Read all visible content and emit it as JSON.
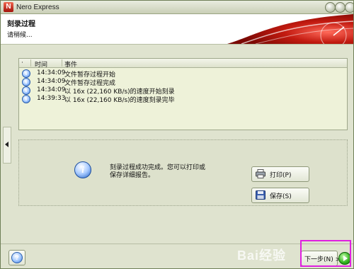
{
  "window": {
    "app_title": "Nero Express",
    "logo_letter": "N"
  },
  "header": {
    "title": "刻录过程",
    "subtitle": "请稍候..."
  },
  "log": {
    "columns": {
      "time": "时间",
      "event": "事件"
    },
    "rows": [
      {
        "time": "14:34:09",
        "event": "文件暂存过程开始",
        "icon": "info-icon"
      },
      {
        "time": "14:34:09",
        "event": "文件暂存过程完成",
        "icon": "info-icon"
      },
      {
        "time": "14:34:09",
        "event": "以 16x (22,160 KB/s)的速度开始刻录",
        "icon": "info-icon"
      },
      {
        "time": "14:39:33",
        "event": "以 16x (22,160 KB/s)的速度刻录完毕",
        "icon": "info-icon"
      }
    ]
  },
  "completion": {
    "message_line1": "刻录过程成功完成。您可以打印或",
    "message_line2": "保存详细报告。",
    "print_label": "打印(P)",
    "save_label": "保存(S)"
  },
  "footer": {
    "help_label": "?",
    "next_label": "下一步(N) >",
    "watermark": "Bai经验"
  },
  "colors": {
    "accent_red": "#c21a10",
    "highlight": "#e020e0"
  }
}
